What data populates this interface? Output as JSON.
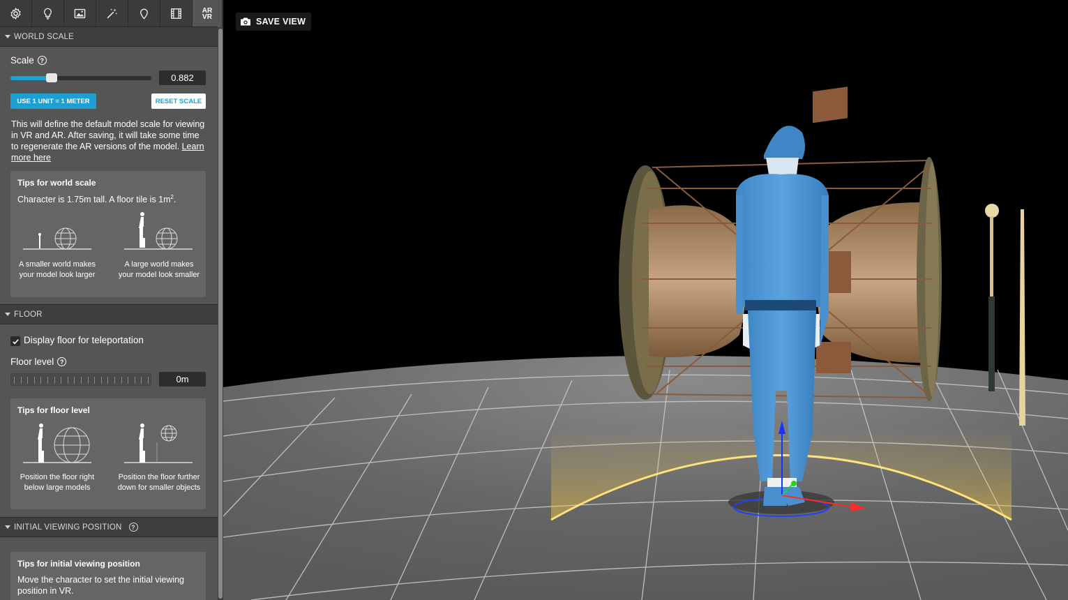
{
  "tabs": [
    {
      "icon": "gear-icon"
    },
    {
      "icon": "lightbulb-icon"
    },
    {
      "icon": "image-icon"
    },
    {
      "icon": "magic-wand-icon"
    },
    {
      "icon": "map-pin-icon"
    },
    {
      "icon": "film-icon"
    },
    {
      "icon": "ar-vr-icon",
      "label_top": "AR",
      "label_bottom": "VR",
      "active": true
    }
  ],
  "world_scale": {
    "header": "WORLD SCALE",
    "scale_label": "Scale",
    "scale_value": "0.882",
    "scale_fraction": 0.29,
    "use_meter_button": "USE 1 UNIT = 1 METER",
    "reset_button": "RESET SCALE",
    "description": "This will define the default model scale for viewing in VR and AR. After saving, it will take some time to regenerate the AR versions of the model.",
    "learn_more": "Learn more here",
    "tips": {
      "title": "Tips for world scale",
      "subtitle_prefix": "Character is 1.75m tall. A floor tile is 1m",
      "subtitle_sup": "2",
      "subtitle_suffix": ".",
      "left_caption": "A smaller world makes your model look larger",
      "right_caption": "A large world makes your model look smaller"
    }
  },
  "floor": {
    "header": "FLOOR",
    "display_floor_label": "Display floor for teleportation",
    "display_floor_checked": true,
    "floor_level_label": "Floor level",
    "floor_level_value": "0m",
    "tips": {
      "title": "Tips for floor level",
      "left_caption": "Position the floor right below large models",
      "right_caption": "Position the floor further down for smaller objects"
    }
  },
  "initial_position": {
    "header": "INITIAL VIEWING POSITION",
    "tips": {
      "title": "Tips for initial viewing position",
      "text": "Move the character to set the initial viewing position in VR."
    }
  },
  "viewport": {
    "save_view_label": "SAVE VIEW",
    "accent": "#1e9fd2"
  }
}
